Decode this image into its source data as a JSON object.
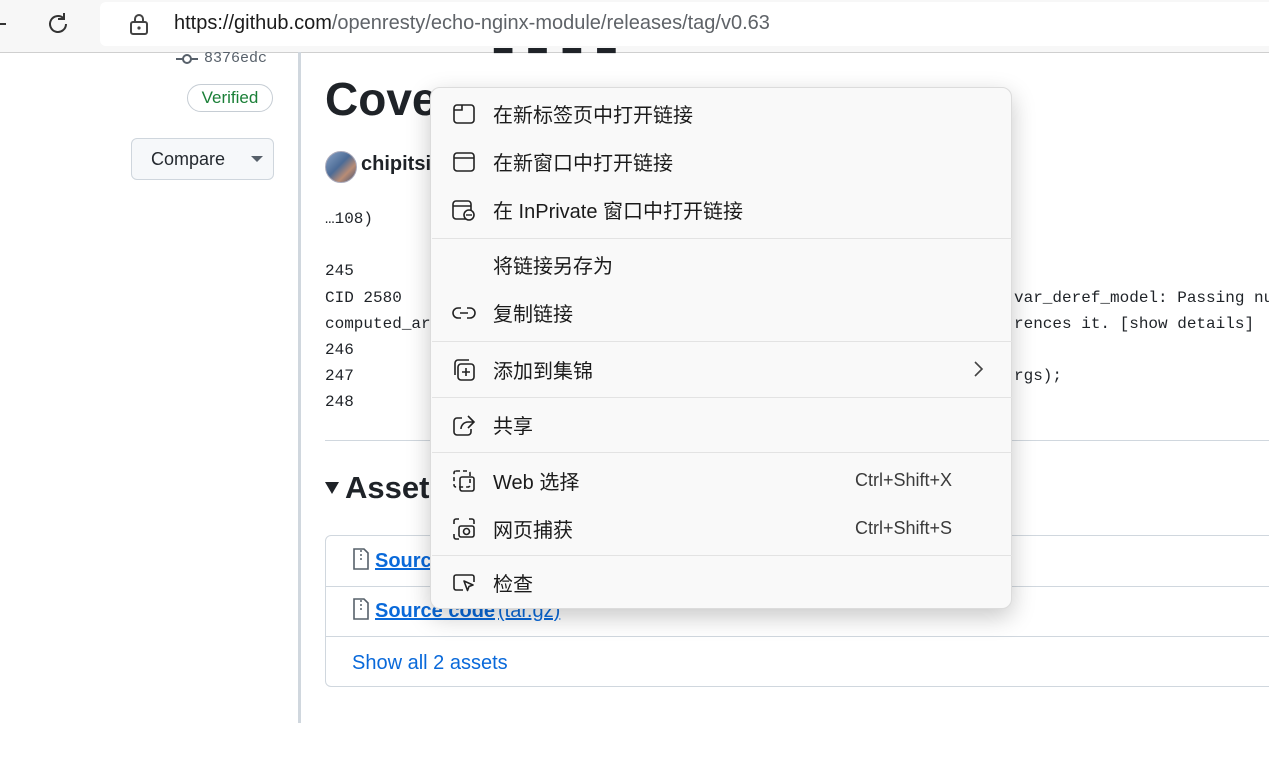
{
  "browser": {
    "url_host": "https://github.com",
    "url_path": "/openresty/echo-nginx-module/releases/tag/v0.63"
  },
  "sidebar": {
    "commit_sha": "8376edc",
    "verified_label": "Verified",
    "compare_label": "Compare"
  },
  "release": {
    "title_partial": "Cove",
    "author": "chipitsi",
    "code_lines": [
      "…108)",
      "245",
      "   CID 2580",
      "var_deref_model: Passing nu",
      "computed_ar",
      "rences it. [show details]",
      "246",
      "247",
      "rgs);",
      "248"
    ]
  },
  "assets": {
    "heading": "Assets",
    "items": [
      {
        "name": "Source",
        "ext": ""
      },
      {
        "name": "Source code",
        "ext": "(tar.gz)"
      }
    ],
    "show_all": "Show all 2 assets"
  },
  "context_menu": {
    "items": [
      {
        "label": "在新标签页中打开链接",
        "icon": "new-tab-icon",
        "shortcut": ""
      },
      {
        "label": "在新窗口中打开链接",
        "icon": "new-window-icon",
        "shortcut": ""
      },
      {
        "label": "在 InPrivate 窗口中打开链接",
        "icon": "inprivate-window-icon",
        "shortcut": ""
      },
      {
        "label": "将链接另存为",
        "icon": "",
        "shortcut": ""
      },
      {
        "label": "复制链接",
        "icon": "link-icon",
        "shortcut": ""
      },
      {
        "label": "添加到集锦",
        "icon": "collections-add-icon",
        "shortcut": ""
      },
      {
        "label": "共享",
        "icon": "share-icon",
        "shortcut": ""
      },
      {
        "label": "Web 选择",
        "icon": "web-select-icon",
        "shortcut": "Ctrl+Shift+X"
      },
      {
        "label": "网页捕获",
        "icon": "web-capture-icon",
        "shortcut": "Ctrl+Shift+S"
      },
      {
        "label": "检查",
        "icon": "inspect-icon",
        "shortcut": ""
      }
    ]
  },
  "colors": {
    "link": "#0969da",
    "verified": "#1a7f37",
    "menu_bg": "#f9f9f9"
  }
}
